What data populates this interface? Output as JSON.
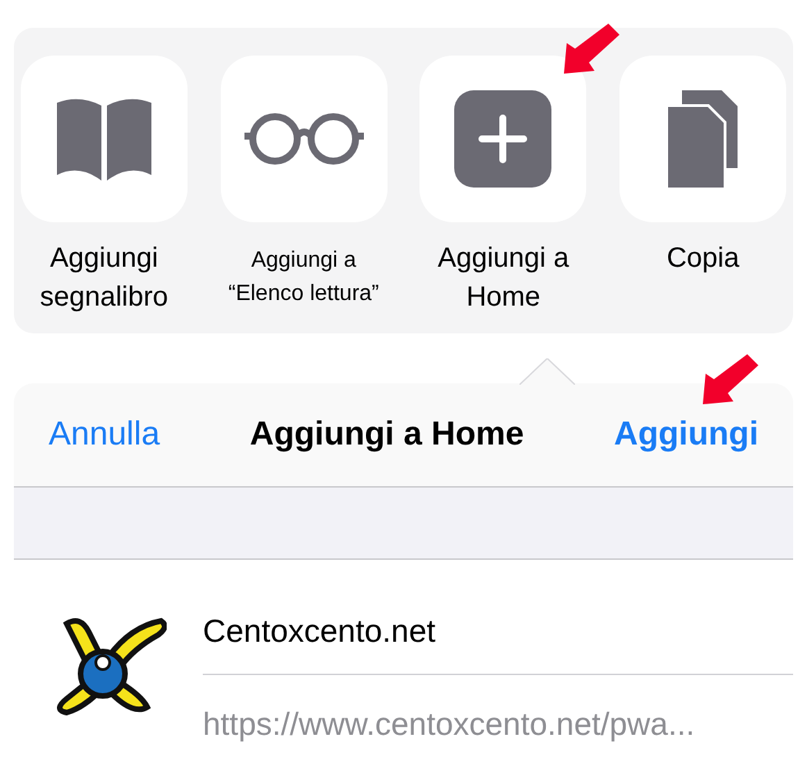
{
  "share_actions": [
    {
      "kind": "bookmark",
      "label": "Aggiungi\nsegnalibro"
    },
    {
      "kind": "reading-list",
      "label": "Aggiungi a\n“Elenco lettura”"
    },
    {
      "kind": "add-home",
      "label": "Aggiungi a\nHome"
    },
    {
      "kind": "copy",
      "label": "Copia"
    }
  ],
  "dialog": {
    "cancel": "Annulla",
    "title": "Aggiungi a Home",
    "confirm": "Aggiungi",
    "name": "Centoxcento.net",
    "url": "https://www.centoxcento.net/pwa..."
  }
}
